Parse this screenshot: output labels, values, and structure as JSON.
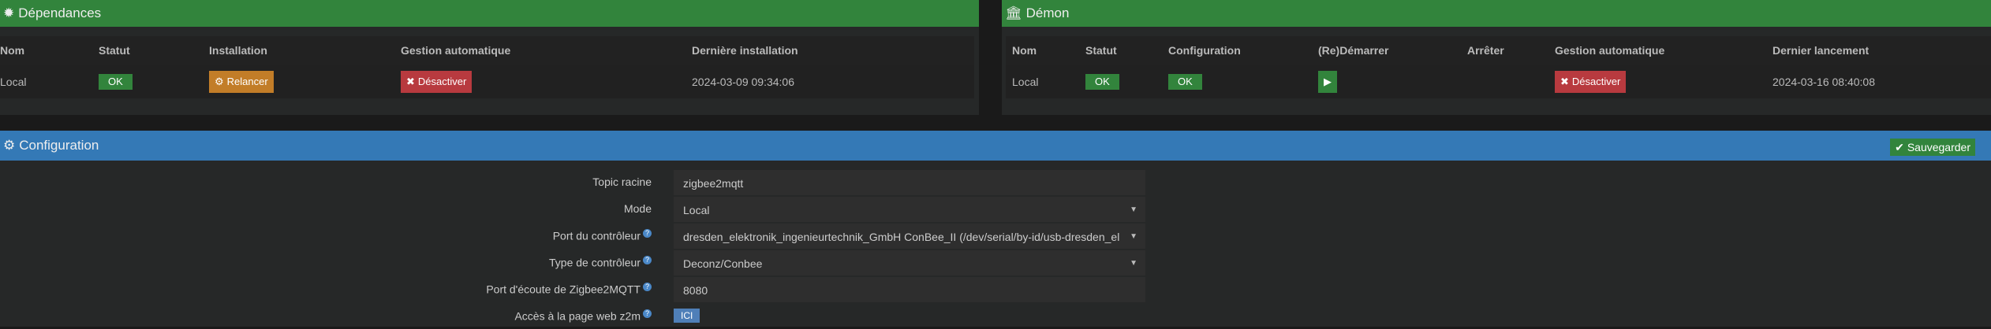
{
  "deps": {
    "title": "Dépendances",
    "headers": [
      "Nom",
      "Statut",
      "Installation",
      "Gestion automatique",
      "Dernière installation"
    ],
    "row": {
      "name": "Local",
      "status": "OK",
      "install": "Relancer",
      "auto": "Désactiver",
      "last": "2024-03-09 09:34:06"
    }
  },
  "daemon": {
    "title": "Démon",
    "headers": [
      "Nom",
      "Statut",
      "Configuration",
      "(Re)Démarrer",
      "Arrêter",
      "Gestion automatique",
      "Dernier lancement"
    ],
    "row": {
      "name": "Local",
      "status": "OK",
      "config": "OK",
      "auto": "Désactiver",
      "last": "2024-03-16 08:40:08"
    }
  },
  "config": {
    "title": "Configuration",
    "save": "Sauvegarder",
    "fields": [
      {
        "label": "Topic racine",
        "value": "zigbee2mqtt"
      },
      {
        "label": "Mode",
        "value": "Local"
      },
      {
        "label": "Port du contrôleur",
        "value": "dresden_elektronik_ingenieurtechnik_GmbH ConBee_II (/dev/serial/by-id/usb-dresden_el"
      },
      {
        "label": "Type de contrôleur",
        "value": "Deconz/Conbee"
      },
      {
        "label": "Port d'écoute de Zigbee2MQTT",
        "value": "8080"
      },
      {
        "label": "Accès à la page web z2m",
        "value": "ICI"
      }
    ]
  },
  "colors": {
    "green": "#32843c",
    "blue": "#3479b6",
    "orange": "#c27d28",
    "red": "#b83a3f"
  }
}
